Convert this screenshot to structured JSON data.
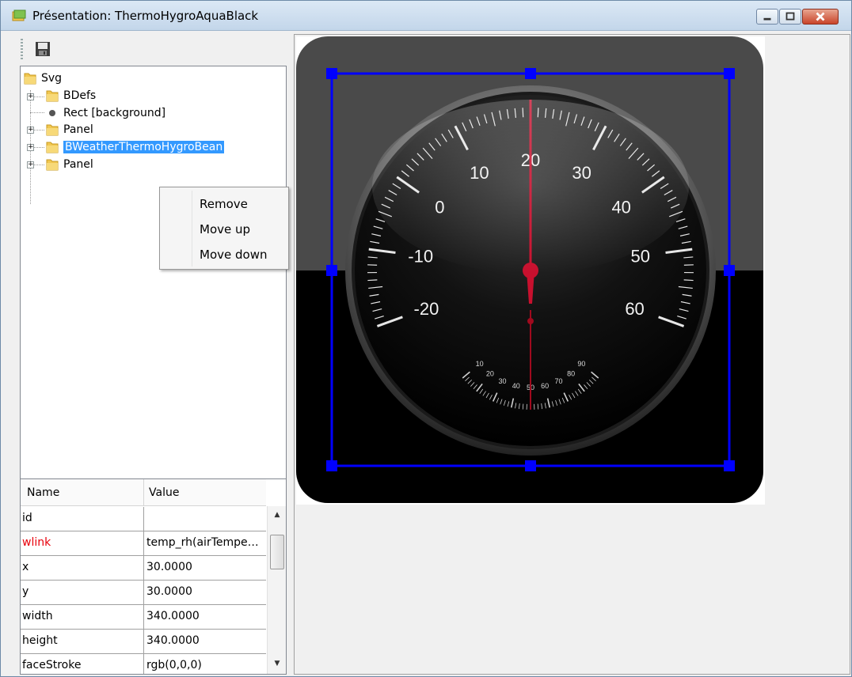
{
  "window": {
    "title": "Présentation: ThermoHygroAquaBlack",
    "controls": {
      "minimize": "minimize-icon",
      "maximize": "maximize-icon",
      "close": "close-icon"
    }
  },
  "toolbar": {
    "save_icon": "save-icon"
  },
  "tree": {
    "nodes": [
      {
        "label": "Svg",
        "icon": "folder-icon"
      },
      {
        "label": "BDefs",
        "icon": "folder-icon"
      },
      {
        "label": "Rect [background]",
        "icon": "bullet-icon"
      },
      {
        "label": "Panel",
        "icon": "folder-icon"
      },
      {
        "label": "BWeatherThermoHygroBean",
        "icon": "folder-icon",
        "selected": true
      },
      {
        "label": "Panel",
        "icon": "folder-icon"
      }
    ]
  },
  "context_menu": {
    "items": [
      {
        "label": "Remove"
      },
      {
        "label": "Move up"
      },
      {
        "label": "Move down"
      }
    ]
  },
  "properties": {
    "headers": {
      "name": "Name",
      "value": "Value"
    },
    "rows": [
      {
        "name": "id",
        "value": ""
      },
      {
        "name": "wlink",
        "value": "temp_rh(airTempe…",
        "highlight": "#e8000b"
      },
      {
        "name": "x",
        "value": "30.0000"
      },
      {
        "name": "y",
        "value": "30.0000"
      },
      {
        "name": "width",
        "value": "340.0000"
      },
      {
        "name": "height",
        "value": "340.0000"
      },
      {
        "name": "faceStroke",
        "value": "rgb(0,0,0)"
      }
    ]
  },
  "gauge": {
    "temperature_scale": [
      "-20",
      "-10",
      "0",
      "10",
      "20",
      "30",
      "40",
      "50",
      "60"
    ],
    "humidity_scale": [
      "90",
      "80",
      "70",
      "60",
      "50",
      "40",
      "30",
      "20",
      "10"
    ],
    "temperature_value": 20,
    "humidity_value": 50,
    "colors": {
      "needle": "#c8102e",
      "selection": "#0000ff",
      "panel_top": "#4a4a4a",
      "panel_bottom": "#000000"
    }
  }
}
